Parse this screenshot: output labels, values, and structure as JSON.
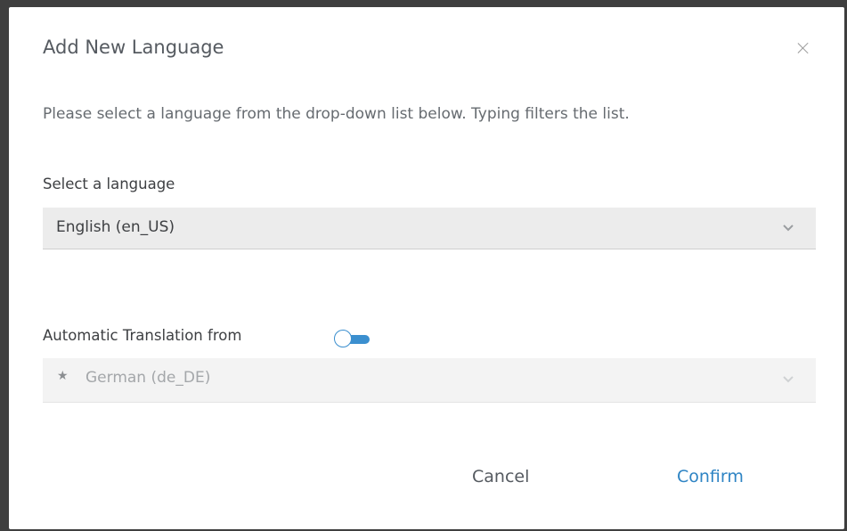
{
  "dialog": {
    "title": "Add New Language",
    "intro": "Please select a language from the drop-down list below. Typing filters the list."
  },
  "language_select": {
    "label": "Select a language",
    "value": "English (en_US)"
  },
  "auto_translation": {
    "label": "Automatic Translation from",
    "toggle_icon": "toggle-switch",
    "source_value": "German (de_DE)",
    "source_icon": "star"
  },
  "actions": {
    "cancel_label": "Cancel",
    "confirm_label": "Confirm"
  },
  "colors": {
    "accent": "#2e84c4",
    "toggle": "#3b8fcf"
  }
}
